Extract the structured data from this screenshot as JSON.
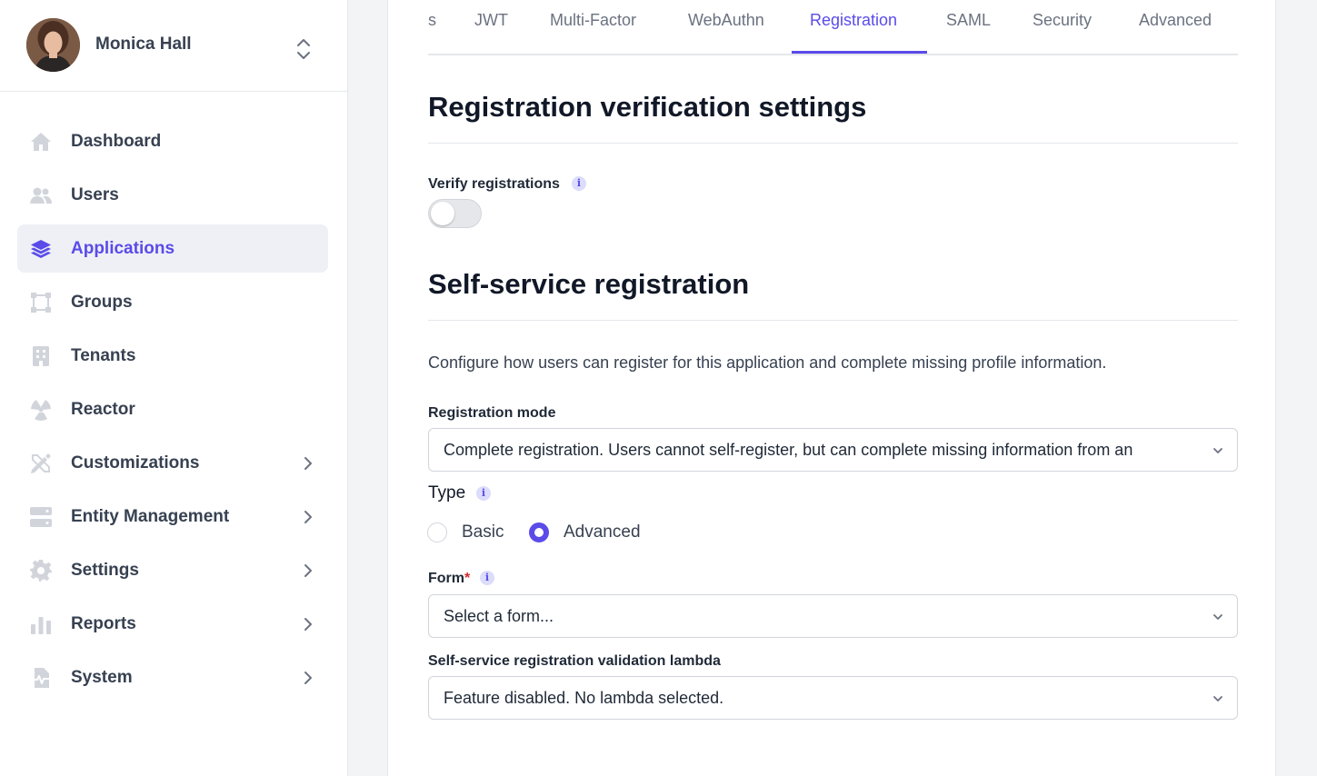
{
  "user": {
    "name": "Monica Hall"
  },
  "sidebar": {
    "items": [
      {
        "label": "Dashboard",
        "icon": "home-icon",
        "has_chevron": false,
        "active": false
      },
      {
        "label": "Users",
        "icon": "users-icon",
        "has_chevron": false,
        "active": false
      },
      {
        "label": "Applications",
        "icon": "layers-icon",
        "has_chevron": false,
        "active": true
      },
      {
        "label": "Groups",
        "icon": "groups-icon",
        "has_chevron": false,
        "active": false
      },
      {
        "label": "Tenants",
        "icon": "building-icon",
        "has_chevron": false,
        "active": false
      },
      {
        "label": "Reactor",
        "icon": "radiation-icon",
        "has_chevron": false,
        "active": false
      },
      {
        "label": "Customizations",
        "icon": "pencil-ruler-icon",
        "has_chevron": true,
        "active": false
      },
      {
        "label": "Entity Management",
        "icon": "server-icon",
        "has_chevron": true,
        "active": false
      },
      {
        "label": "Settings",
        "icon": "gear-icon",
        "has_chevron": true,
        "active": false
      },
      {
        "label": "Reports",
        "icon": "bar-chart-icon",
        "has_chevron": true,
        "active": false
      },
      {
        "label": "System",
        "icon": "system-icon",
        "has_chevron": true,
        "active": false
      }
    ]
  },
  "tabs": [
    {
      "label": "s",
      "active": false
    },
    {
      "label": "JWT",
      "active": false
    },
    {
      "label": "Multi-Factor",
      "active": false
    },
    {
      "label": "WebAuthn",
      "active": false
    },
    {
      "label": "Registration",
      "active": true
    },
    {
      "label": "SAML",
      "active": false
    },
    {
      "label": "Security",
      "active": false
    },
    {
      "label": "Advanced",
      "active": false
    }
  ],
  "verification": {
    "heading": "Registration verification settings",
    "verify_label": "Verify registrations",
    "verify_enabled": false
  },
  "self_service": {
    "heading": "Self-service registration",
    "description": "Configure how users can register for this application and complete missing profile information.",
    "mode_label": "Registration mode",
    "mode_value": "Complete registration. Users cannot self-register, but can complete missing information from an",
    "type_label": "Type",
    "type_options": [
      "Basic",
      "Advanced"
    ],
    "type_selected": "Advanced",
    "form_label": "Form",
    "form_required_mark": "*",
    "form_value": "Select a form...",
    "lambda_label": "Self-service registration validation lambda",
    "lambda_value": "Feature disabled. No lambda selected."
  },
  "colors": {
    "accent": "#5b4be8",
    "required": "#dc2626"
  },
  "info_glyph": "i"
}
